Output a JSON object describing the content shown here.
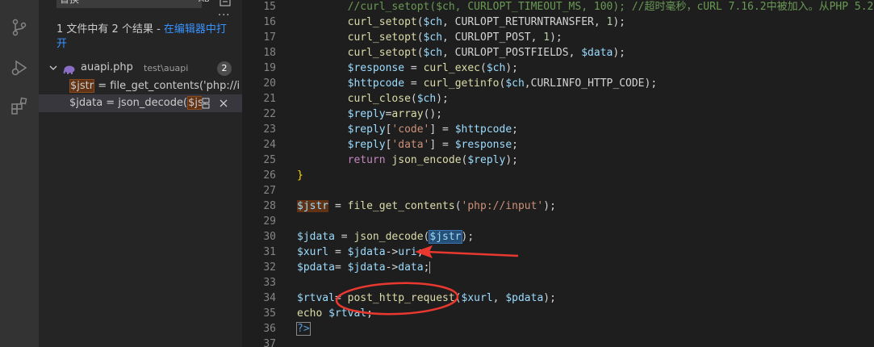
{
  "sidebar": {
    "replace_value": "替换",
    "preserve_case_label": "AB",
    "more_label": "···",
    "summary_text": "1 文件中有 2 个结果 - ",
    "open_in_editor_label": "在编辑器中打开",
    "file": {
      "name": "auapi.php",
      "path": "test\\auapi",
      "count": "2"
    },
    "matches": [
      {
        "match": "$jstr",
        "rest": " = file_get_contents('php://inp..."
      },
      {
        "prefix": "$jdata = json_decode(",
        "match": "$js",
        "rest": "..."
      }
    ]
  },
  "editor": {
    "lines": [
      {
        "n": "15",
        "tokens": [
          {
            "t": "        "
          },
          {
            "t": "//curl_setopt($ch, CURLOPT_TIMEOUT_MS, 100); //超时毫秒，cURL 7.16.2中被加入。从PHP 5.2",
            "c": "com"
          }
        ]
      },
      {
        "n": "16",
        "tokens": [
          {
            "t": "        "
          },
          {
            "t": "curl_setopt",
            "c": "fn"
          },
          {
            "t": "("
          },
          {
            "t": "$ch",
            "c": "var"
          },
          {
            "t": ", CURLOPT_RETURNTRANSFER, "
          },
          {
            "t": "1",
            "c": "num"
          },
          {
            "t": ");"
          }
        ]
      },
      {
        "n": "17",
        "tokens": [
          {
            "t": "        "
          },
          {
            "t": "curl_setopt",
            "c": "fn"
          },
          {
            "t": "("
          },
          {
            "t": "$ch",
            "c": "var"
          },
          {
            "t": ", CURLOPT_POST, "
          },
          {
            "t": "1",
            "c": "num"
          },
          {
            "t": ");"
          }
        ]
      },
      {
        "n": "18",
        "tokens": [
          {
            "t": "        "
          },
          {
            "t": "curl_setopt",
            "c": "fn"
          },
          {
            "t": "("
          },
          {
            "t": "$ch",
            "c": "var"
          },
          {
            "t": ", CURLOPT_POSTFIELDS, "
          },
          {
            "t": "$data",
            "c": "var"
          },
          {
            "t": ");"
          }
        ]
      },
      {
        "n": "19",
        "tokens": [
          {
            "t": "        "
          },
          {
            "t": "$response",
            "c": "var"
          },
          {
            "t": " = "
          },
          {
            "t": "curl_exec",
            "c": "fn"
          },
          {
            "t": "("
          },
          {
            "t": "$ch",
            "c": "var"
          },
          {
            "t": ");"
          }
        ]
      },
      {
        "n": "20",
        "tokens": [
          {
            "t": "        "
          },
          {
            "t": "$httpcode",
            "c": "var"
          },
          {
            "t": " = "
          },
          {
            "t": "curl_getinfo",
            "c": "fn"
          },
          {
            "t": "("
          },
          {
            "t": "$ch",
            "c": "var"
          },
          {
            "t": ",CURLINFO_HTTP_CODE);"
          }
        ]
      },
      {
        "n": "21",
        "tokens": [
          {
            "t": "        "
          },
          {
            "t": "curl_close",
            "c": "fn"
          },
          {
            "t": "("
          },
          {
            "t": "$ch",
            "c": "var"
          },
          {
            "t": ");"
          }
        ]
      },
      {
        "n": "22",
        "tokens": [
          {
            "t": "        "
          },
          {
            "t": "$reply",
            "c": "var"
          },
          {
            "t": "="
          },
          {
            "t": "array",
            "c": "fn"
          },
          {
            "t": "();"
          }
        ]
      },
      {
        "n": "23",
        "tokens": [
          {
            "t": "        "
          },
          {
            "t": "$reply",
            "c": "var"
          },
          {
            "t": "["
          },
          {
            "t": "'code'",
            "c": "str"
          },
          {
            "t": "] = "
          },
          {
            "t": "$httpcode",
            "c": "var"
          },
          {
            "t": ";"
          }
        ]
      },
      {
        "n": "24",
        "tokens": [
          {
            "t": "        "
          },
          {
            "t": "$reply",
            "c": "var"
          },
          {
            "t": "["
          },
          {
            "t": "'data'",
            "c": "str"
          },
          {
            "t": "] = "
          },
          {
            "t": "$response",
            "c": "var"
          },
          {
            "t": ";"
          }
        ]
      },
      {
        "n": "25",
        "tokens": [
          {
            "t": "        "
          },
          {
            "t": "return",
            "c": "kw"
          },
          {
            "t": " "
          },
          {
            "t": "json_encode",
            "c": "fn"
          },
          {
            "t": "("
          },
          {
            "t": "$reply",
            "c": "var"
          },
          {
            "t": ");"
          }
        ]
      },
      {
        "n": "26",
        "tokens": [
          {
            "t": "}",
            "c": "brace"
          }
        ]
      },
      {
        "n": "27",
        "tokens": []
      },
      {
        "n": "28",
        "tokens": [
          {
            "t": "$jstr",
            "c": "var",
            "h": "find"
          },
          {
            "t": " = "
          },
          {
            "t": "file_get_contents",
            "c": "fn"
          },
          {
            "t": "("
          },
          {
            "t": "'php://input'",
            "c": "str"
          },
          {
            "t": ");"
          }
        ]
      },
      {
        "n": "29",
        "tokens": []
      },
      {
        "n": "30",
        "tokens": [
          {
            "t": "$jdata",
            "c": "var"
          },
          {
            "t": " = "
          },
          {
            "t": "json_decode",
            "c": "fn"
          },
          {
            "t": "("
          },
          {
            "t": "$jstr",
            "c": "var",
            "h": "find-sel"
          },
          {
            "t": ");"
          }
        ]
      },
      {
        "n": "31",
        "tokens": [
          {
            "t": "$xurl",
            "c": "var"
          },
          {
            "t": " = "
          },
          {
            "t": "$jdata",
            "c": "var"
          },
          {
            "t": "->"
          },
          {
            "t": "uri",
            "c": "var"
          },
          {
            "t": ";"
          }
        ]
      },
      {
        "n": "32",
        "tokens": [
          {
            "t": "$pdata",
            "c": "var"
          },
          {
            "t": "= "
          },
          {
            "t": "$jdata",
            "c": "var"
          },
          {
            "t": "->"
          },
          {
            "t": "data",
            "c": "var"
          },
          {
            "t": ";"
          },
          {
            "cursor": true
          }
        ]
      },
      {
        "n": "33",
        "tokens": []
      },
      {
        "n": "34",
        "tokens": [
          {
            "t": "$rtval",
            "c": "var"
          },
          {
            "t": "= "
          },
          {
            "t": "post_http_request",
            "c": "fn"
          },
          {
            "t": "("
          },
          {
            "t": "$xurl",
            "c": "var"
          },
          {
            "t": ", "
          },
          {
            "t": "$pdata",
            "c": "var"
          },
          {
            "t": ");"
          }
        ]
      },
      {
        "n": "35",
        "tokens": [
          {
            "t": "echo",
            "c": "fn"
          },
          {
            "t": " "
          },
          {
            "t": "$rtval",
            "c": "var"
          },
          {
            "t": ";"
          }
        ]
      },
      {
        "n": "36",
        "tokens": [
          {
            "t": "?>",
            "c": "tag",
            "h": "bracket-box"
          }
        ]
      },
      {
        "n": "37",
        "tokens": []
      }
    ]
  },
  "colors": {
    "accent_link": "#3794ff",
    "find_highlight": "#613214",
    "annotation_red": "#e8382f"
  }
}
